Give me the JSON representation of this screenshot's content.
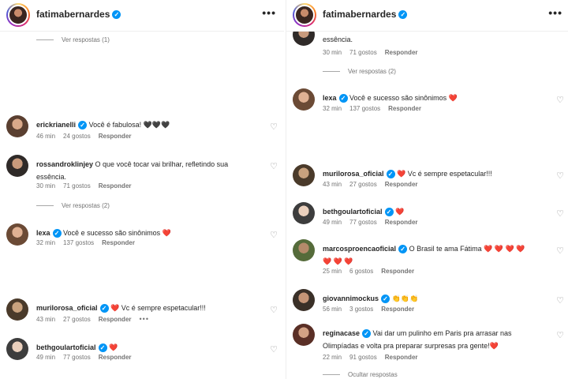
{
  "header": {
    "username": "fatimabernardes",
    "more_label": "•••"
  },
  "labels": {
    "likes_suffix": "gostos",
    "reply": "Responder"
  },
  "left": {
    "top_replies": "Ver respostas (1)",
    "comments": [
      {
        "user": "erickrianelli",
        "verified": true,
        "text": "Você é fabulosa! 🖤🖤🖤",
        "time": "46 min",
        "likes": "24 gostos"
      },
      {
        "user": "rossandroklinjey",
        "verified": false,
        "text": "O que você tocar vai brilhar, refletindo sua essência.",
        "time": "30 min",
        "likes": "71 gostos"
      },
      {
        "user": "lexa",
        "verified": true,
        "text": "Você e sucesso são sinônimos ❤️",
        "time": "32 min",
        "likes": "137 gostos"
      },
      {
        "user": "murilorosa_oficial",
        "verified": true,
        "text": "❤️ Vc é sempre espetacular!!!",
        "time": "43 min",
        "likes": "27 gostos"
      },
      {
        "user": "bethgoulartoficial",
        "verified": true,
        "text": "❤️",
        "time": "49 min",
        "likes": "77 gostos"
      }
    ],
    "replies_2": "Ver respostas (2)",
    "extra_dots": "•••"
  },
  "right": {
    "partial_text": "essência.",
    "partial_time": "30 min",
    "partial_likes": "71 gostos",
    "replies_2": "Ver respostas (2)",
    "comments": [
      {
        "user": "lexa",
        "verified": true,
        "text": "Você e sucesso são sinônimos ❤️",
        "time": "32 min",
        "likes": "137 gostos"
      },
      {
        "user": "murilorosa_oficial",
        "verified": true,
        "text": "❤️ Vc é sempre espetacular!!!",
        "time": "43 min",
        "likes": "27 gostos"
      },
      {
        "user": "bethgoulartoficial",
        "verified": true,
        "text": "❤️",
        "time": "49 min",
        "likes": "77 gostos"
      },
      {
        "user": "marcosproencaoficial",
        "verified": true,
        "text": "O Brasil te ama Fátima ❤️ ❤️ ❤️ ❤️ ❤️ ❤️ ❤️",
        "time": "25 min",
        "likes": "6 gostos"
      },
      {
        "user": "giovannimockus",
        "verified": true,
        "text": "👏👏👏",
        "time": "56 min",
        "likes": "3 gostos"
      },
      {
        "user": "reginacase",
        "verified": true,
        "text": "Vai dar um pulinho em Paris pra arrasar nas Olimpíadas e volta pra preparar surpresas pra gente!❤️",
        "time": "22 min",
        "likes": "91 gostos"
      }
    ],
    "hide_replies": "Ocultar respostas"
  },
  "colors": {
    "verified": "#0095f6",
    "heart_red": "#ed4956",
    "meta_gray": "#737373"
  }
}
